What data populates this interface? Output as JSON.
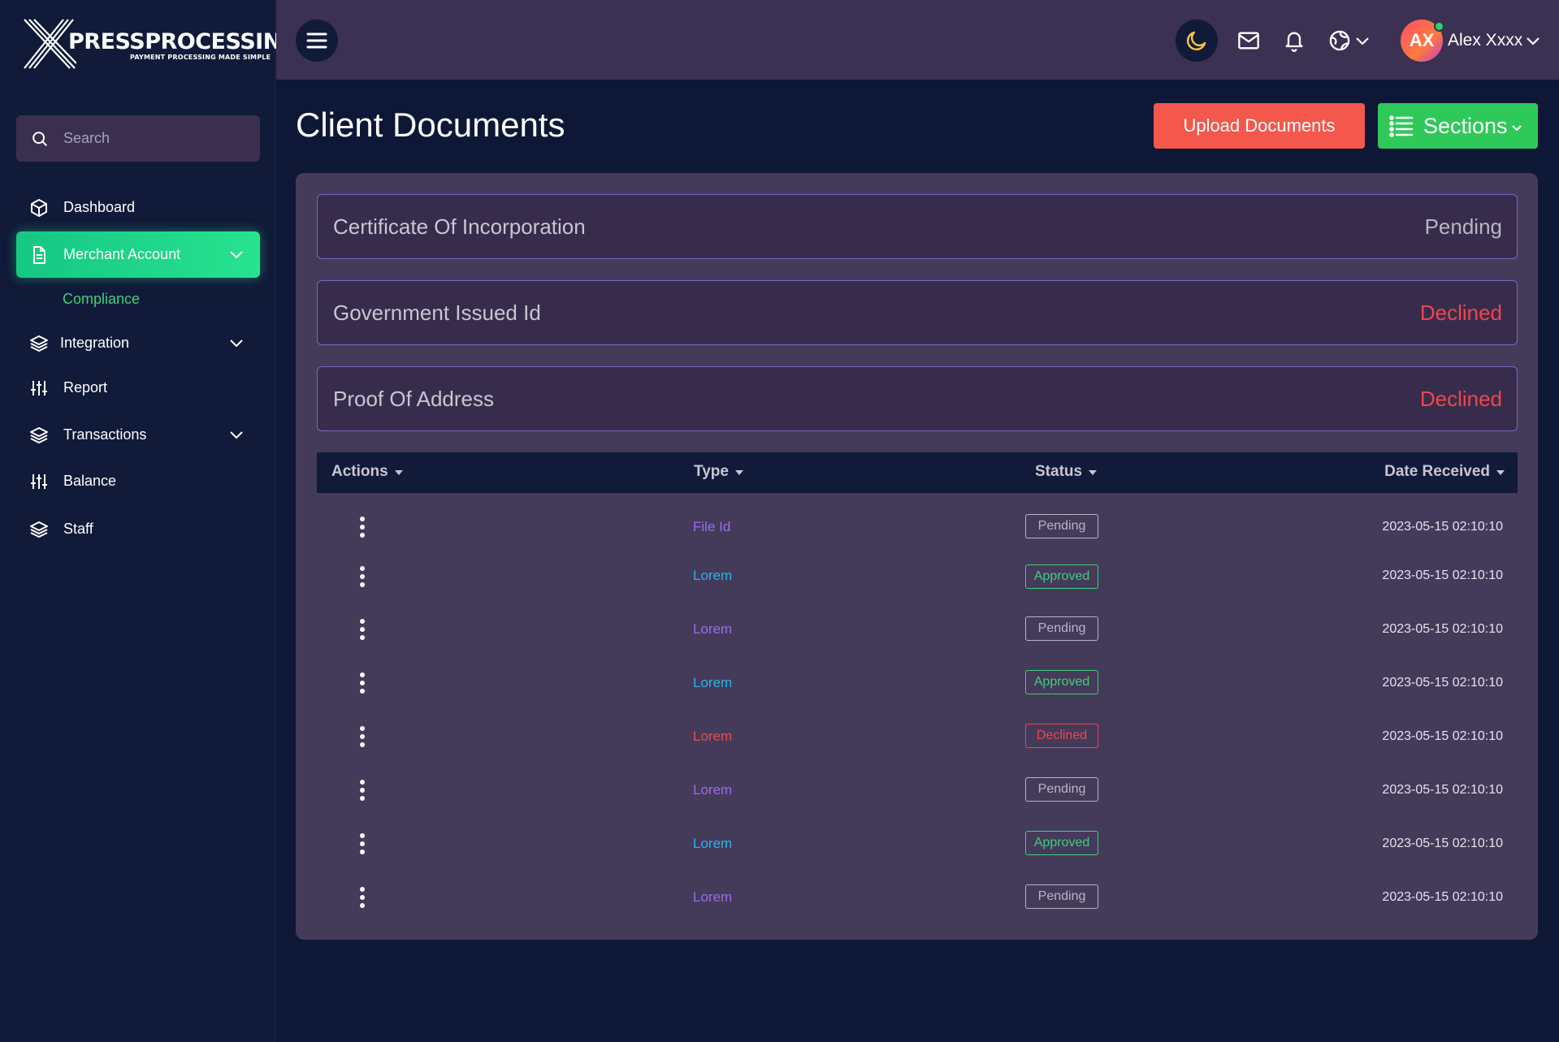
{
  "brand": {
    "name": "PRESSPROCESSING",
    "tagline": "PAYMENT PROCESSING MADE SIMPLE"
  },
  "search": {
    "placeholder": "Search"
  },
  "sidebar": {
    "items": [
      {
        "label": "Dashboard",
        "icon": "cube-icon"
      },
      {
        "label": "Merchant Account",
        "icon": "document-icon",
        "active": true
      },
      {
        "label": "Integration",
        "icon": "layers-icon"
      },
      {
        "label": "Report",
        "icon": "sliders-icon"
      },
      {
        "label": "Transactions",
        "icon": "layers-icon"
      },
      {
        "label": "Balance",
        "icon": "sliders-icon"
      },
      {
        "label": "Staff",
        "icon": "layers-icon"
      }
    ],
    "sub_item": "Compliance"
  },
  "topbar": {
    "user_initials": "AX",
    "user_name": "Alex Xxxx"
  },
  "page": {
    "title": "Client Documents",
    "upload_label": "Upload Documents",
    "sections_label": "Sections"
  },
  "documents": [
    {
      "name": "Certificate Of Incorporation",
      "status": "Pending"
    },
    {
      "name": "Government Issued Id",
      "status": "Declined"
    },
    {
      "name": "Proof Of Address",
      "status": "Declined"
    }
  ],
  "table": {
    "headers": [
      "Actions",
      "Type",
      "Status",
      "Date Received"
    ],
    "rows": [
      {
        "type": "File Id",
        "status": "Pending",
        "date": "2023-05-15 02:10:10"
      },
      {
        "type": "Lorem",
        "status": "Approved",
        "date": "2023-05-15 02:10:10"
      },
      {
        "type": "Lorem",
        "status": "Pending",
        "date": "2023-05-15 02:10:10"
      },
      {
        "type": "Lorem",
        "status": "Approved",
        "date": "2023-05-15 02:10:10"
      },
      {
        "type": "Lorem",
        "status": "Declined",
        "date": "2023-05-15 02:10:10"
      },
      {
        "type": "Lorem",
        "status": "Pending",
        "date": "2023-05-15 02:10:10"
      },
      {
        "type": "Lorem",
        "status": "Approved",
        "date": "2023-05-15 02:10:10"
      },
      {
        "type": "Lorem",
        "status": "Pending",
        "date": "2023-05-15 02:10:10"
      }
    ]
  },
  "colors": {
    "background": "#0f1736",
    "sidebar": "#111a38",
    "topbar": "#3b3152",
    "panel": "#443a5a",
    "active_nav": "#16c784",
    "upload_button": "#f4574c",
    "sections_button": "#2fc95a",
    "pending": "#b9b5c4",
    "approved": "#3fd07a",
    "declined": "#f0454d"
  }
}
